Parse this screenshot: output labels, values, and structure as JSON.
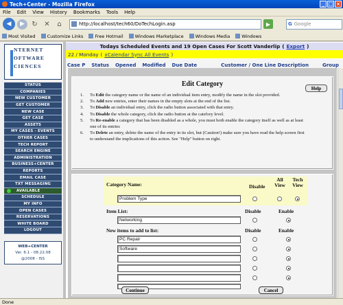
{
  "window": {
    "title": "Tech+Center - Mozilla Firefox"
  },
  "menu": [
    "File",
    "Edit",
    "View",
    "History",
    "Bookmarks",
    "Tools",
    "Help"
  ],
  "nav": {
    "url": "http://localhost/tech60/DoTechLogin.asp",
    "search_placeholder": "Google",
    "search_brand": "G"
  },
  "bookmarks": [
    "Most Visited",
    "Customize Links",
    "Free Hotmail",
    "Windows Marketplace",
    "Windows Media",
    "Windows"
  ],
  "logo": {
    "line1": "NTERNET",
    "line2": "OFTWARE",
    "line3": "CIENCES"
  },
  "sidebar": {
    "items": [
      "STATUS",
      "COMPANIES",
      "NEW CUSTOMER",
      "GET CUSTOMER",
      "NEW CASE",
      "GET CASE",
      "ASSETS",
      "MY CASES - EVENTS",
      "OTHER CASES",
      "TECH REPORT",
      "SEARCH ENGINE",
      "ADMINISTRATION",
      "BUSINESS+CENTER",
      "REPORTS",
      "EMAIL CASE",
      "TXT MESSAGING",
      "AVAILABLE",
      "SCHEDULE",
      "MY INFO",
      "OPEN CASES",
      "RESERVATIONS",
      "WHITE BOARD",
      "LOGOUT"
    ],
    "status_color": "#41d13a",
    "version_title": "WEB+CENTER",
    "version": "Ver. 6.1 - 08.22.08",
    "copyright": "@2008 - ISS"
  },
  "header": {
    "events_text": "Todays Scheduled Events and 19  Open Cases For  Scott Vanderlip",
    "export_label": "Export",
    "date_text": "22 / Monday",
    "sync_label": "xCalendar Sync All Events"
  },
  "columns": [
    "Case P",
    "Status",
    "Opened",
    "Modified",
    "Due Date",
    "Customer / One Line Description",
    "Group"
  ],
  "edit": {
    "title": "Edit Category",
    "help_label": "Help",
    "instructions": [
      {
        "n": "1.",
        "a": "To ",
        "b": "Edit",
        "c": " the category name or the name of an individual item entry, modify the name in the slot provided."
      },
      {
        "n": "2.",
        "a": "To ",
        "b": "Add",
        "c": " new entries, enter their names in the empty slots at the end of the list."
      },
      {
        "n": "3.",
        "a": "To ",
        "b": "Disable",
        "c": " an individual entry, click the radio button associated with that entry."
      },
      {
        "n": "4.",
        "a": "To ",
        "b": "Disable",
        "c": " the whole category, click the radio button at the catefory level."
      },
      {
        "n": "5.",
        "a": "To ",
        "b": "Re-enable",
        "c": " a category that has been disabled as a whole, you must both enable the category itself as well as at least one of its entries"
      },
      {
        "n": "6.",
        "a": "To ",
        "b": "Delete",
        "c": " an entry, delete the name of the entry in its slot, but (Caution!) make sure you have read the help screen first to understand the implications of this action. See \"Help\" button on right."
      }
    ]
  },
  "form": {
    "category_label": "Category Name:",
    "category_value": "Problem Type",
    "col_disable": "Disable",
    "col_all_view": "All View",
    "col_tech_view": "Tech View",
    "col_enable": "Enable",
    "item_list_label": "Item List:",
    "items": [
      "Networking"
    ],
    "new_items_label": "New items to add to list:",
    "new_items": [
      "PC Repair",
      "Software",
      "",
      "",
      "",
      ""
    ],
    "continue_label": "Continue",
    "cancel_label": "Cancel"
  },
  "status_bar": "Done"
}
